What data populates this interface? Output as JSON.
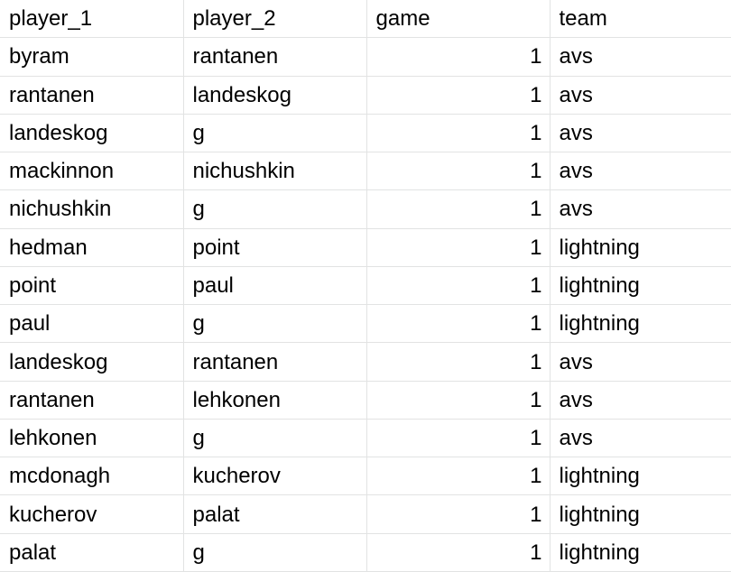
{
  "columns": [
    "player_1",
    "player_2",
    "game",
    "team"
  ],
  "rows": [
    [
      "byram",
      "rantanen",
      "1",
      "avs"
    ],
    [
      "rantanen",
      "landeskog",
      "1",
      "avs"
    ],
    [
      "landeskog",
      "g",
      "1",
      "avs"
    ],
    [
      "mackinnon",
      "nichushkin",
      "1",
      "avs"
    ],
    [
      "nichushkin",
      "g",
      "1",
      "avs"
    ],
    [
      "hedman",
      "point",
      "1",
      "lightning"
    ],
    [
      "point",
      "paul",
      "1",
      "lightning"
    ],
    [
      "paul",
      "g",
      "1",
      "lightning"
    ],
    [
      "landeskog",
      "rantanen",
      "1",
      "avs"
    ],
    [
      "rantanen",
      "lehkonen",
      "1",
      "avs"
    ],
    [
      "lehkonen",
      "g",
      "1",
      "avs"
    ],
    [
      "mcdonagh",
      "kucherov",
      "1",
      "lightning"
    ],
    [
      "kucherov",
      "palat",
      "1",
      "lightning"
    ],
    [
      "palat",
      "g",
      "1",
      "lightning"
    ]
  ]
}
